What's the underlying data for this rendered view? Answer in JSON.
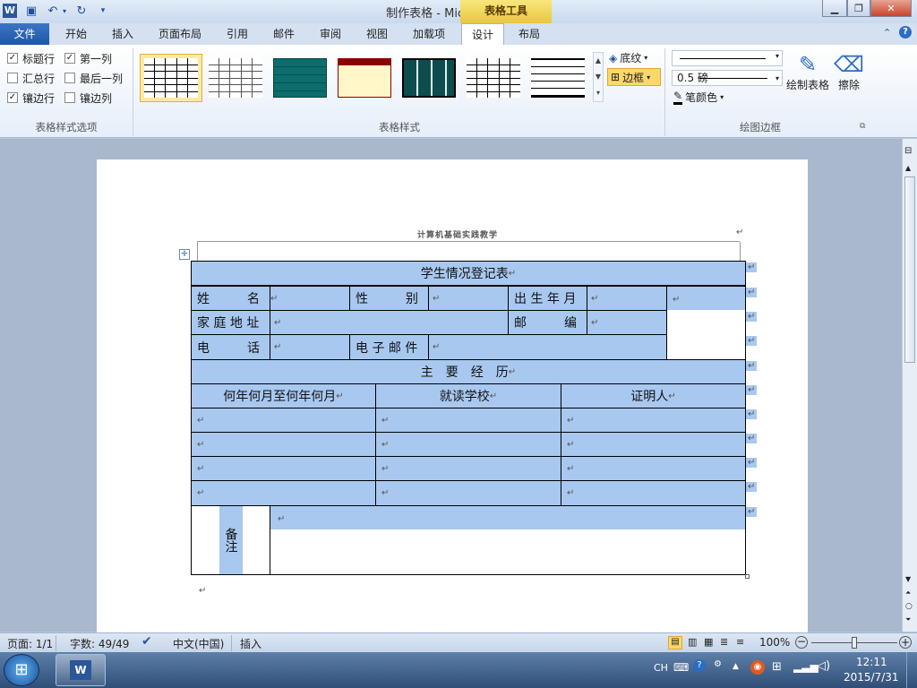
{
  "window": {
    "title": "制作表格 - Microsoft Word",
    "context_tab": "表格工具"
  },
  "tabs": [
    "文件",
    "开始",
    "插入",
    "页面布局",
    "引用",
    "邮件",
    "审阅",
    "视图",
    "加载项",
    "设计",
    "布局"
  ],
  "ribbon": {
    "style_options": {
      "items": [
        {
          "label": "标题行",
          "checked": true
        },
        {
          "label": "第一列",
          "checked": true
        },
        {
          "label": "汇总行",
          "checked": false
        },
        {
          "label": "最后一列",
          "checked": false
        },
        {
          "label": "镶边行",
          "checked": true
        },
        {
          "label": "镶边列",
          "checked": false
        }
      ],
      "group_label": "表格样式选项"
    },
    "table_styles": {
      "group_label": "表格样式"
    },
    "shading_label": "底纹",
    "borders_label": "边框",
    "pen_weight": "0.5 磅",
    "pen_color_label": "笔颜色",
    "draw_table_label": "绘制表格",
    "eraser_label": "擦除",
    "draw_borders_group_label": "绘图边框"
  },
  "document": {
    "header_text": "计算机基础实践教学",
    "table": {
      "title": "学生情况登记表",
      "name_label": "姓　　　名",
      "gender_label": "性　　　别",
      "birth_label": "出 生 年 月",
      "address_label": "家 庭 地 址",
      "postcode_label": "邮　　　编",
      "phone_label": "电　　　话",
      "email_label": "电 子 邮 件",
      "experience_heading": "主　要　经　历",
      "col_period": "何年何月至何年何月",
      "col_school": "就读学校",
      "col_witness": "证明人",
      "remarks_label": "备注"
    },
    "para_mark": "↵"
  },
  "statusbar": {
    "page": "页面: 1/1",
    "words": "字数: 49/49",
    "language": "中文(中国)",
    "mode": "插入",
    "zoom": "100%"
  },
  "taskbar": {
    "ime": "CH",
    "time": "12:11",
    "date": "2015/7/31"
  }
}
